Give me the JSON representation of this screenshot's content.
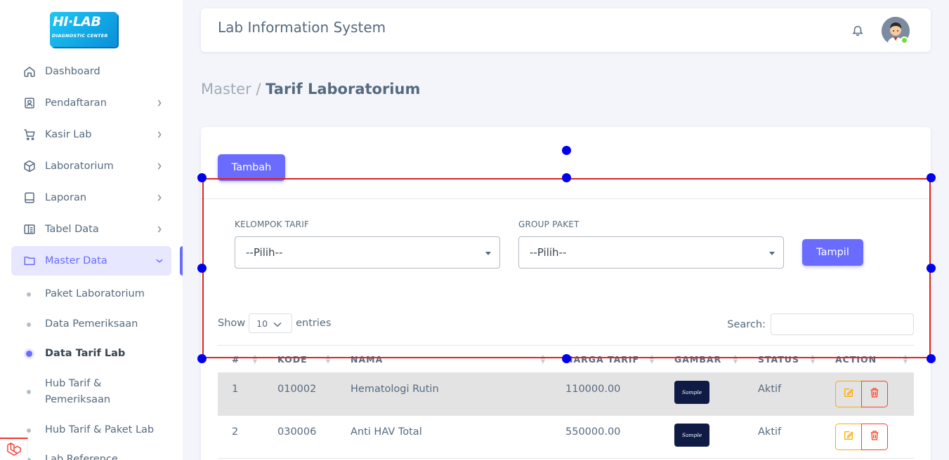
{
  "sidebar": {
    "logo_main": "HI·LAB",
    "logo_sub": "DIAGNOSTIC CENTER",
    "menu": [
      {
        "label": "Dashboard",
        "icon": "home-icon"
      },
      {
        "label": "Pendaftaran",
        "icon": "user-badge-icon"
      },
      {
        "label": "Kasir Lab",
        "icon": "cart-icon"
      },
      {
        "label": "Laboratorium",
        "icon": "cube-icon"
      },
      {
        "label": "Laporan",
        "icon": "book-icon"
      },
      {
        "label": "Tabel Data",
        "icon": "table-icon"
      },
      {
        "label": "Master Data",
        "icon": "folder-icon",
        "active": true
      }
    ],
    "submenu": [
      {
        "label": "Paket Laboratorium"
      },
      {
        "label": "Data Pemeriksaan"
      },
      {
        "label": "Data Tarif Lab",
        "active": true
      },
      {
        "label": "Hub Tarif &",
        "label2": "Pemeriksaan"
      },
      {
        "label": "Hub Tarif & Paket Lab"
      },
      {
        "label": "Lab Reference"
      }
    ]
  },
  "navbar": {
    "title": "Lab Information System"
  },
  "breadcrumb": {
    "parent": "Master /",
    "current": "Tarif Laboratorium"
  },
  "card": {
    "tambah_label": "Tambah",
    "filters": {
      "kelompok_label": "KELOMPOK TARIF",
      "kelompok_value": "--Pilih--",
      "group_label": "GROUP PAKET",
      "group_value": "--Pilih--",
      "tampil_label": "Tampil"
    },
    "table_controls": {
      "show": "Show",
      "length_value": "10",
      "entries": "entries",
      "search_label": "Search:"
    },
    "table": {
      "headers": [
        "#",
        "KODE",
        "NAMA",
        "HARGA TARIF",
        "GAMBAR",
        "STATUS",
        "ACTION"
      ],
      "rows": [
        {
          "no": "1",
          "kode": "010002",
          "nama": "Hematologi Rutin",
          "harga": "110000.00",
          "gambar": "Sample",
          "status": "Aktif"
        },
        {
          "no": "2",
          "kode": "030006",
          "nama": "Anti HAV Total",
          "harga": "550000.00",
          "gambar": "Sample",
          "status": "Aktif"
        }
      ]
    }
  },
  "colors": {
    "primary": "#696cff",
    "edit": "#ffab00",
    "delete": "#ff3e1d",
    "selection_outline": "#e0201e",
    "handle": "#0000ee"
  }
}
